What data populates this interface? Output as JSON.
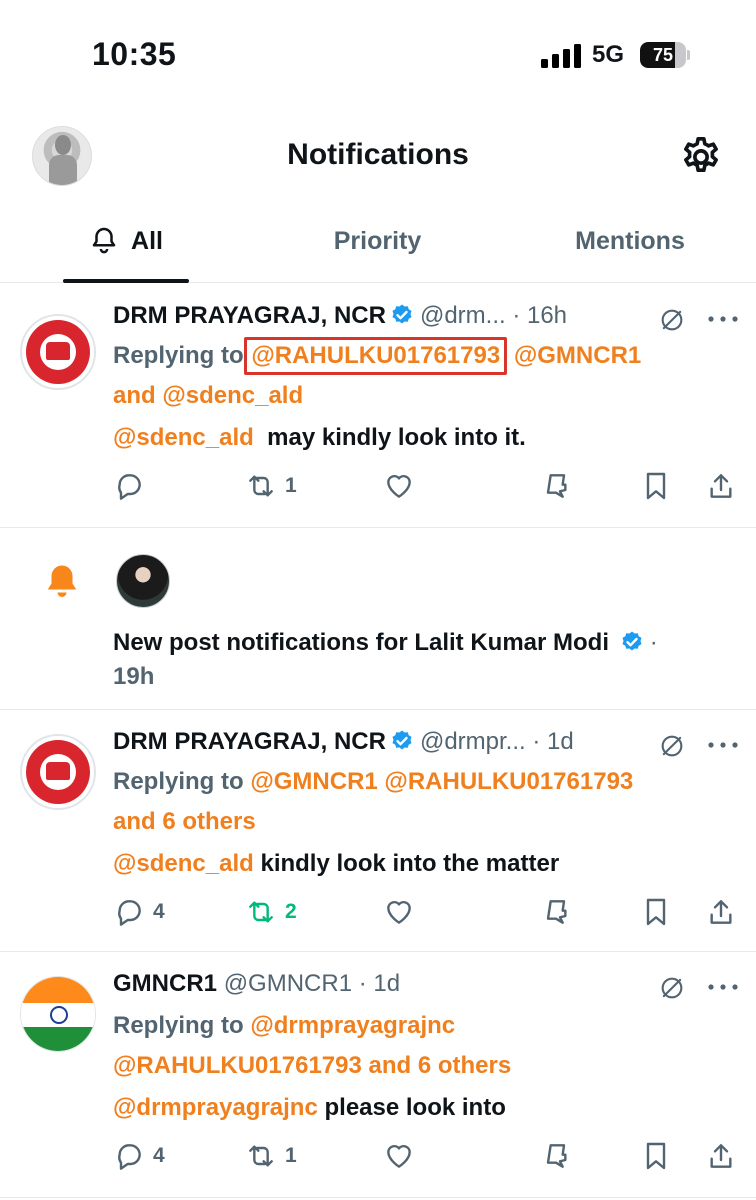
{
  "status_bar": {
    "time": "10:35",
    "network": "5G",
    "battery": "75",
    "battery_level": 0.75
  },
  "header": {
    "title": "Notifications",
    "profile_icon": "avatar",
    "settings_icon": "gear-icon"
  },
  "tabs": [
    {
      "label": "All",
      "active": true,
      "icon": "bell-icon"
    },
    {
      "label": "Priority",
      "active": false
    },
    {
      "label": "Mentions",
      "active": false
    }
  ],
  "notifications": [
    {
      "name": "DRM PRAYAGRAJ, NCR",
      "handle": "@drm...",
      "time": "· 16h",
      "replying_prefix": "Replying to",
      "mentions_line1": [
        "@RAHULKU01761793",
        "@GMNCR1"
      ],
      "and_word": "and",
      "mentions_line2": "@sdenc_ald",
      "body_mention": "@sdenc_ald",
      "body_text": "may kindly look into it.",
      "reply_count": "",
      "retweet_count": "1",
      "retweeted": false
    },
    {
      "type": "new-post",
      "text": "New post notifications for Lalit Kumar Modi",
      "dot": "·",
      "time": "19h"
    },
    {
      "name": "DRM PRAYAGRAJ, NCR",
      "handle": "@drmpr...",
      "time": "· 1d",
      "replying_prefix": "Replying to",
      "mentions_line1": [
        "@GMNCR1",
        "@RAHULKU01761793"
      ],
      "others_line": "and 6 others",
      "body_mention": "@sdenc_ald",
      "body_text": "kindly look into the matter",
      "reply_count": "4",
      "retweet_count": "2",
      "retweeted": true
    },
    {
      "name": "GMNCR1",
      "handle": "@GMNCR1",
      "time": "· 1d",
      "replying_prefix": "Replying to",
      "mention_a": "@drmprayagrajnc",
      "mention_b": "@RAHULKU01761793",
      "others_line": "and 6 others",
      "body_mention": "@drmprayagrajnc",
      "body_text": "please look into",
      "reply_count": "4",
      "retweet_count": "1",
      "retweeted": false
    }
  ],
  "colors": {
    "mention": "#f07f1e",
    "verified": "#1d9bf0",
    "retweet_active": "#00ba7c",
    "highlight_box": "#d8342a"
  }
}
